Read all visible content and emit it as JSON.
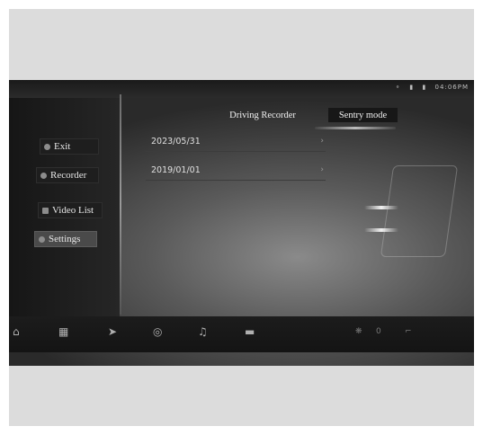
{
  "status_bar": {
    "time": "04:06",
    "meridiem": "PM"
  },
  "tabs": {
    "driving_recorder": "Driving Recorder",
    "sentry_mode": "Sentry mode"
  },
  "sidebar": {
    "items": [
      {
        "label": "Exit",
        "icon": "arrow-left-icon"
      },
      {
        "label": "Recorder",
        "icon": "record-icon"
      },
      {
        "label": "Video List",
        "icon": "folder-icon"
      },
      {
        "label": "Settings",
        "icon": "gear-icon"
      }
    ]
  },
  "dates": [
    {
      "label": "2023/05/31"
    },
    {
      "label": "2019/01/01"
    }
  ],
  "dock": {
    "items": [
      "home-icon",
      "apps-icon",
      "navigation-icon",
      "voice-icon",
      "music-icon",
      "car-icon"
    ],
    "volume": "0"
  }
}
